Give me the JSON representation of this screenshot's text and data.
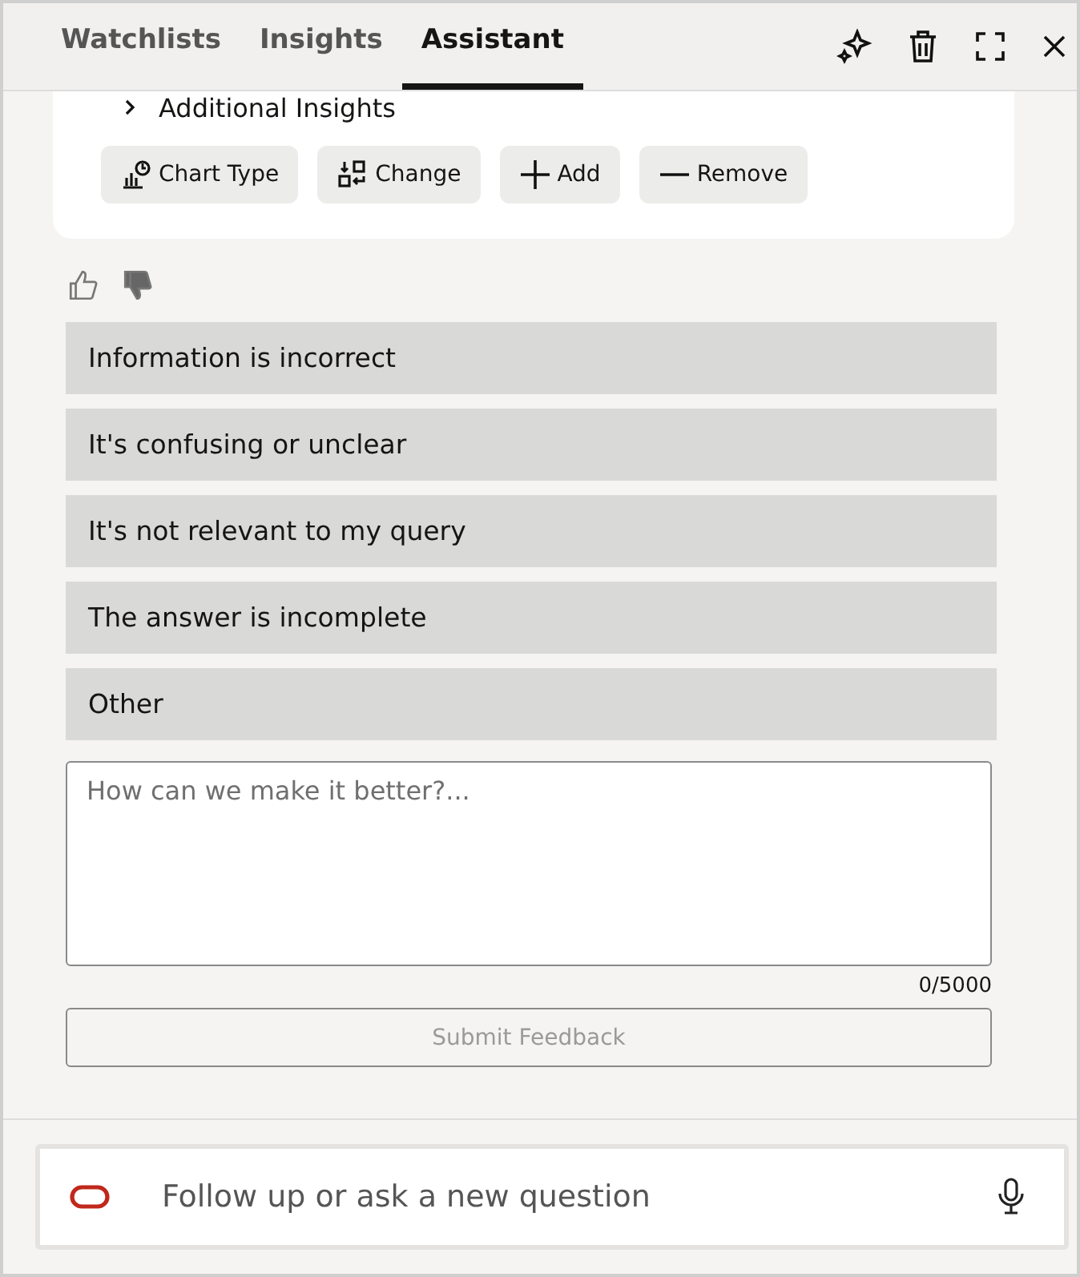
{
  "tabs": [
    {
      "label": "Watchlists",
      "selected": false
    },
    {
      "label": "Insights",
      "selected": false
    },
    {
      "label": "Assistant",
      "selected": true
    }
  ],
  "card": {
    "disclosure": "Additional Insights",
    "actions": [
      {
        "kind": "chart",
        "label": "Chart Type"
      },
      {
        "kind": "change",
        "label": "Change"
      },
      {
        "kind": "add",
        "label": "Add"
      },
      {
        "kind": "remove",
        "label": "Remove"
      }
    ]
  },
  "rating": {
    "thumbs_up": false,
    "thumbs_down": true
  },
  "reasons": [
    {
      "label": "Information is incorrect"
    },
    {
      "label": "It's confusing or unclear"
    },
    {
      "label": "It's not relevant to my query"
    },
    {
      "label": "The answer is incomplete"
    },
    {
      "label": "Other"
    }
  ],
  "feedback": {
    "placeholder": "How can we make it better?...",
    "counter": "0/5000",
    "submit": {
      "label": "Submit Feedback",
      "disabled": true
    }
  },
  "prompt": {
    "placeholder": "Follow up or ask a new question"
  }
}
